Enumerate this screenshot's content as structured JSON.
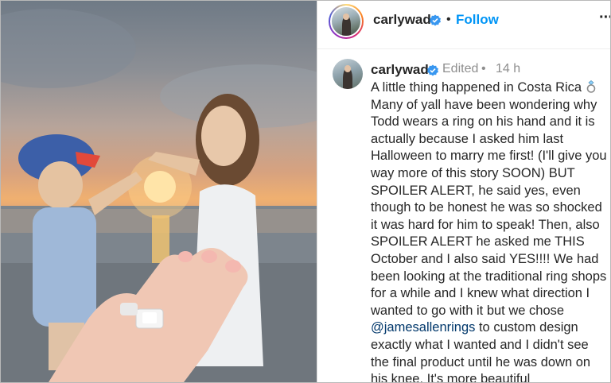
{
  "post": {
    "image_alt": "",
    "header": {
      "username": "carlywad",
      "separator": "•",
      "follow_label": "Follow",
      "more_label": "···"
    },
    "caption": {
      "username": "carlywad",
      "edited_label": "Edited",
      "separator": "•",
      "time_ago": "14 h",
      "text_before_emoji": "A little thing happened in Costa Rica ",
      "emoji": "ring-emoji",
      "text_after_emoji": "\nMany of yall have been wondering why Todd wears a ring on his hand and it is actually because I asked him last Halloween to marry me first! (I'll give you way more of this story SOON) BUT SPOILER ALERT, he said yes, even though to be honest he was so shocked it was hard for him to speak! Then, also SPOILER ALERT he asked me THIS October and I also said YES!!!! We had been looking at the traditional ring shops for a while and I knew what direction I wanted to go with it but we chose ",
      "mention": "@jamesallenrings",
      "text_after_mention": " to custom design exactly what I wanted and I didn't see the final product until he was down on his knee. It's more beautiful"
    },
    "icons": {
      "verified": "verified-badge-icon",
      "more": "more-options-icon"
    },
    "colors": {
      "follow": "#0095f6",
      "mention": "#00376b",
      "verified": "#3897f0",
      "muted_text": "#8e8e8e"
    }
  }
}
